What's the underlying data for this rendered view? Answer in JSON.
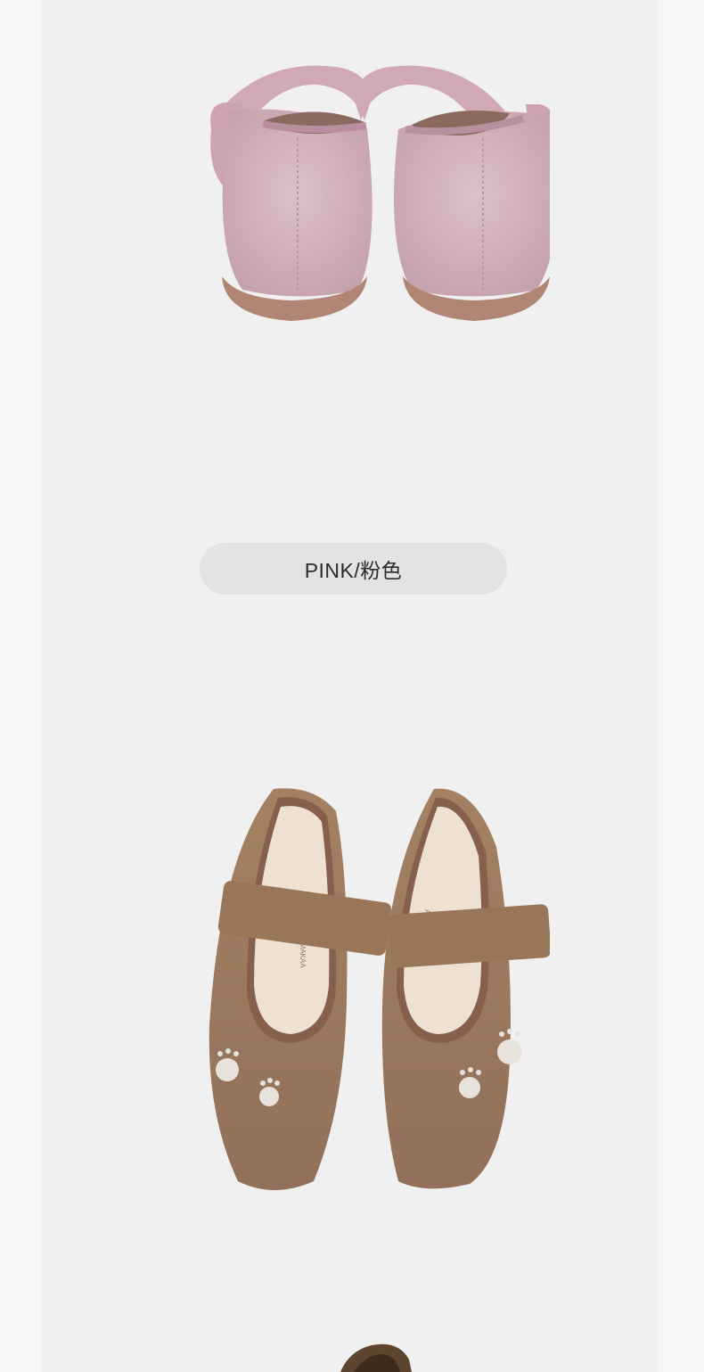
{
  "color_label": {
    "text": "PINK/粉色"
  },
  "products": [
    {
      "name": "pink-suede-shoes-back-view",
      "color": "#d2b3bd",
      "sole": "#b08573"
    },
    {
      "name": "brown-suede-shoes-top-view",
      "color": "#9c7a5f",
      "trim": "#86604d",
      "insole": "#efe1d1",
      "embroidery": "#e7e3dc",
      "insole_brand": "LITTLE BLUE LAMB · AIMAKAA"
    }
  ]
}
